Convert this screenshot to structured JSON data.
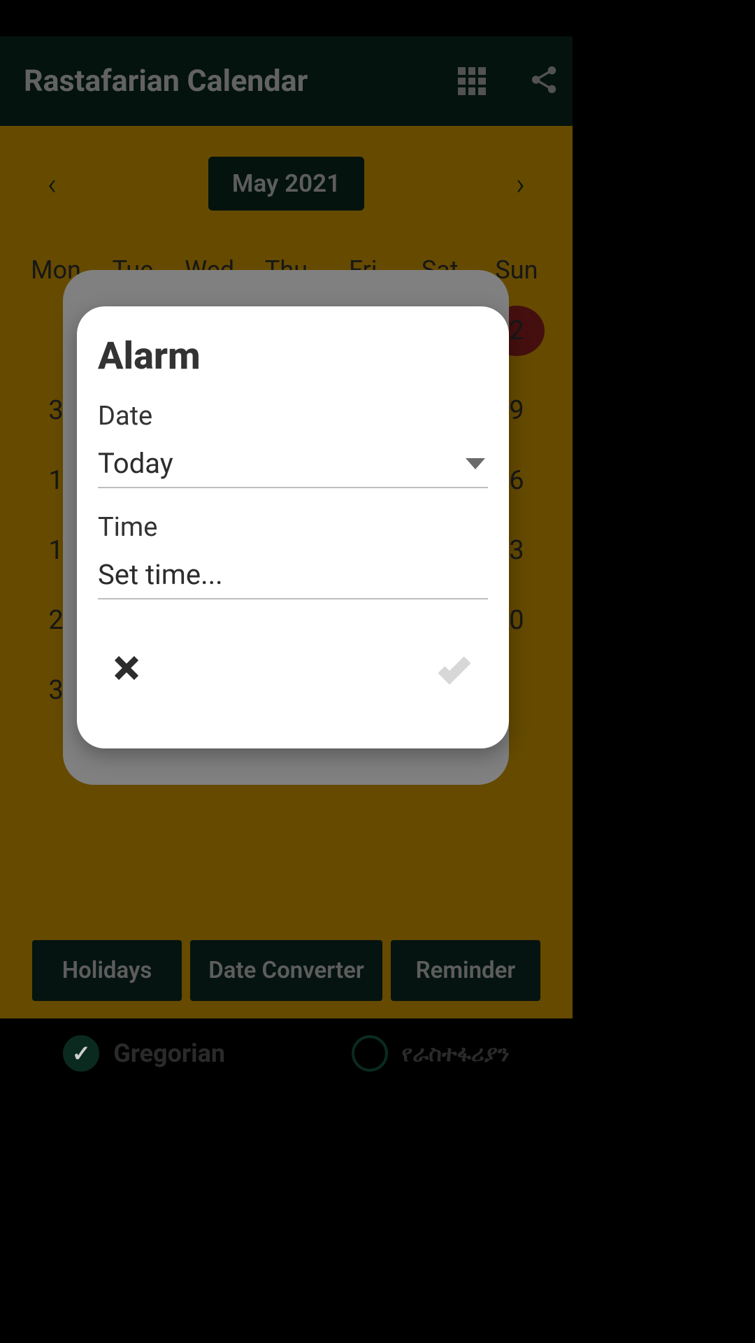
{
  "header": {
    "title": "Rastafarian Calendar"
  },
  "month_nav": {
    "label": "May 2021"
  },
  "weekdays": [
    "Mon",
    "Tue",
    "Wed",
    "Thu",
    "Fri",
    "Sat",
    "Sun"
  ],
  "days": {
    "row1_last": "2",
    "row2_first": "3",
    "row2_last": "9",
    "row3_first": "1",
    "row3_last": "6",
    "row4_first": "1",
    "row4_last": "3",
    "row5_first": "2",
    "row5_last": "0",
    "row6_first": "3"
  },
  "buttons": {
    "holidays": "Holidays",
    "converter": "Date Converter",
    "reminder": "Reminder"
  },
  "radios": {
    "gregorian": "Gregorian",
    "rastafarian": "የራስተፋሪያን"
  },
  "dialog": {
    "title": "Alarm",
    "date_label": "Date",
    "date_value": "Today",
    "time_label": "Time",
    "time_placeholder": "Set time..."
  }
}
